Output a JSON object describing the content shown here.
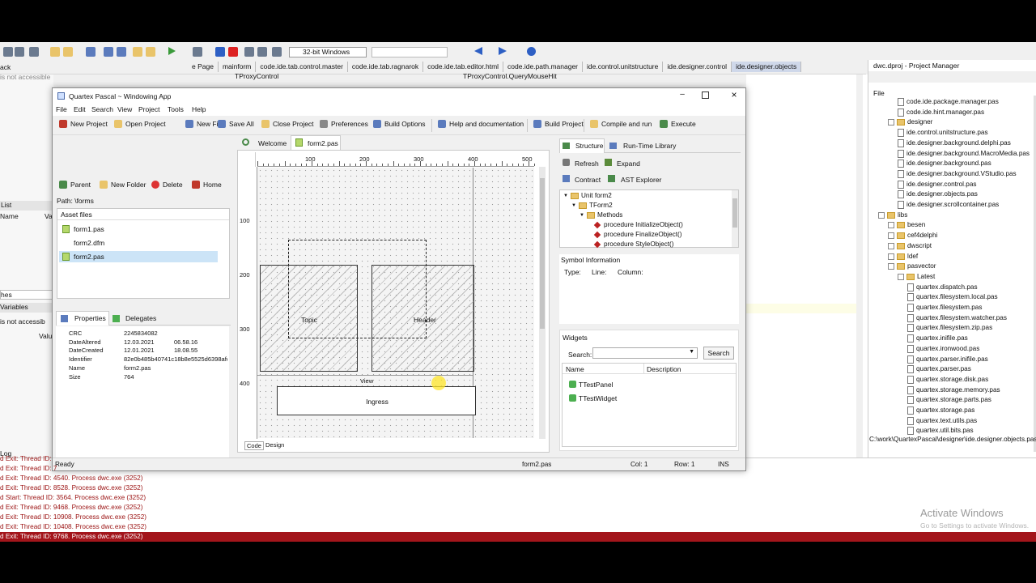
{
  "bg": {
    "tabs": [
      "e Page",
      "mainform",
      "code.ide.tab.control.master",
      "code.ide.tab.ragnarok",
      "code.ide.tab.editor.html",
      "code.ide.path.manager",
      "ide.control.unitstructure",
      "ide.designer.control",
      "ide.designer.objects"
    ],
    "platform": "32-bit Windows",
    "class_left": "TProxyControl",
    "method_right": "TProxyControl.QueryMouseHit",
    "left_texts": [
      "ack",
      "is not accessible",
      "List",
      "Name",
      "Va",
      "hes",
      "Variables",
      "is not accessib",
      "Valu",
      "Log"
    ],
    "editor_lines": []
  },
  "project_manager": {
    "title": "dwc.dproj - Project Manager",
    "tab": "File",
    "items": [
      {
        "t": "code.ide.package.manager.pas",
        "k": "doc",
        "l": 2
      },
      {
        "t": "code.ide.hint.manager.pas",
        "k": "doc",
        "l": 2
      },
      {
        "t": "designer",
        "k": "fold",
        "l": 1
      },
      {
        "t": "ide.control.unitstructure.pas",
        "k": "doc",
        "l": 2
      },
      {
        "t": "ide.designer.background.delphi.pas",
        "k": "doc",
        "l": 2
      },
      {
        "t": "ide.designer.background.MacroMedia.pas",
        "k": "doc",
        "l": 2
      },
      {
        "t": "ide.designer.background.pas",
        "k": "doc",
        "l": 2
      },
      {
        "t": "ide.designer.background.VStudio.pas",
        "k": "doc",
        "l": 2
      },
      {
        "t": "ide.designer.control.pas",
        "k": "doc",
        "l": 2
      },
      {
        "t": "ide.designer.objects.pas",
        "k": "doc",
        "l": 2
      },
      {
        "t": "ide.designer.scrollcontainer.pas",
        "k": "doc",
        "l": 2
      },
      {
        "t": "libs",
        "k": "fold",
        "l": 0
      },
      {
        "t": "besen",
        "k": "fold",
        "l": 1
      },
      {
        "t": "cef4delphi",
        "k": "fold",
        "l": 1
      },
      {
        "t": "dwscript",
        "k": "fold",
        "l": 1
      },
      {
        "t": "ldef",
        "k": "fold",
        "l": 1
      },
      {
        "t": "pasvector",
        "k": "fold",
        "l": 1
      },
      {
        "t": "Latest",
        "k": "fold",
        "l": 2
      },
      {
        "t": "quartex.dispatch.pas",
        "k": "doc",
        "l": 3
      },
      {
        "t": "quartex.filesystem.local.pas",
        "k": "doc",
        "l": 3
      },
      {
        "t": "quartex.filesystem.pas",
        "k": "doc",
        "l": 3
      },
      {
        "t": "quartex.filesystem.watcher.pas",
        "k": "doc",
        "l": 3
      },
      {
        "t": "quartex.filesystem.zip.pas",
        "k": "doc",
        "l": 3
      },
      {
        "t": "quartex.inifile.pas",
        "k": "doc",
        "l": 3
      },
      {
        "t": "quartex.ironwood.pas",
        "k": "doc",
        "l": 3
      },
      {
        "t": "quartex.parser.inifile.pas",
        "k": "doc",
        "l": 3
      },
      {
        "t": "quartex.parser.pas",
        "k": "doc",
        "l": 3
      },
      {
        "t": "quartex.storage.disk.pas",
        "k": "doc",
        "l": 3
      },
      {
        "t": "quartex.storage.memory.pas",
        "k": "doc",
        "l": 3
      },
      {
        "t": "quartex.storage.parts.pas",
        "k": "doc",
        "l": 3
      },
      {
        "t": "quartex.storage.pas",
        "k": "doc",
        "l": 3
      },
      {
        "t": "quartex.text.utils.pas",
        "k": "doc",
        "l": 3
      },
      {
        "t": "quartex.util.bits.pas",
        "k": "doc",
        "l": 3
      }
    ],
    "path": "C:\\work\\QuartexPascal\\designer\\ide.designer.objects.pas"
  },
  "log": {
    "lines": [
      "d Exit: Thread ID: ",
      "d Exit: Thread ID: 7",
      "d Exit: Thread ID: 4540. Process dwc.exe (3252)",
      "d Exit: Thread ID: 8528. Process dwc.exe (3252)",
      "d Start: Thread ID: 3564. Process dwc.exe (3252)",
      "d Exit: Thread ID: 9468. Process dwc.exe (3252)",
      "d Exit: Thread ID: 10908. Process dwc.exe (3252)",
      "d Exit: Thread ID: 10408. Process dwc.exe (3252)",
      "d Exit: Thread ID: 9768. Process dwc.exe (3252)"
    ]
  },
  "watermark": {
    "line1": "Activate Windows",
    "line2": "Go to Settings to activate Windows."
  },
  "app": {
    "title": "Quartex Pascal ~ Windowing App",
    "menu": [
      "File",
      "Edit",
      "Search",
      "View",
      "Project",
      "Tools",
      "Help"
    ],
    "toolbar": [
      "New Project",
      "Open Project",
      "New File",
      "Save All",
      "Close Project",
      "Preferences",
      "Build Options",
      "Help and documentation",
      "Build Project",
      "Compile and run",
      "Execute"
    ],
    "filebar": [
      "Parent",
      "New Folder",
      "Delete",
      "Home"
    ],
    "path": "Path: \\forms",
    "asset_header": "Asset files",
    "assets": [
      "form1.pas",
      "form2.dfm",
      "form2.pas"
    ],
    "selected_asset": 2,
    "prop_tabs": [
      "Properties",
      "Delegates"
    ],
    "properties": [
      {
        "k": "CRC",
        "v": "2245834082",
        "v2": ""
      },
      {
        "k": "DateAltered",
        "v": "12.03.2021",
        "v2": "06.58.16"
      },
      {
        "k": "DateCreated",
        "v": "12.01.2021",
        "v2": "18.08.55"
      },
      {
        "k": "Identifier",
        "v": "82e0b485b40741c18b8e5525d6398afc",
        "v2": ""
      },
      {
        "k": "Name",
        "v": "form2.pas",
        "v2": ""
      },
      {
        "k": "Size",
        "v": "764",
        "v2": ""
      }
    ],
    "doc_tabs": [
      "Welcome",
      "form2.pas"
    ],
    "ruler_top": [
      "100",
      "200",
      "300",
      "400",
      "500"
    ],
    "ruler_left": [
      "100",
      "200",
      "300",
      "400"
    ],
    "canvas_labels": {
      "topic": "Topic",
      "header": "Header",
      "view": "View",
      "ingress": "Ingress"
    },
    "bottom_tabs": [
      "Code",
      "Design"
    ],
    "right_tabs": [
      "Structure",
      "Run-Time Library"
    ],
    "right_buttons": [
      "Refresh",
      "Expand",
      "Contract",
      "AST Explorer"
    ],
    "tree": [
      {
        "t": "Unit form2",
        "l": 0,
        "k": "fold"
      },
      {
        "t": "TForm2",
        "l": 1,
        "k": "fold"
      },
      {
        "t": "Methods",
        "l": 2,
        "k": "fold"
      },
      {
        "t": "procedure InitializeObject()",
        "l": 3,
        "k": "red"
      },
      {
        "t": "procedure FinalizeObject()",
        "l": 3,
        "k": "red"
      },
      {
        "t": "procedure StyleObject()",
        "l": 3,
        "k": "red"
      }
    ],
    "symbol": {
      "title": "Symbol Information",
      "type": "Type:",
      "line": "Line:",
      "column": "Column:"
    },
    "widgets": {
      "title": "Widgets",
      "search_label": "Search:",
      "search_button": "Search",
      "col_name": "Name",
      "col_desc": "Description",
      "items": [
        "TTestPanel",
        "TTestWidget"
      ]
    },
    "status": {
      "ready": "Ready",
      "file": "form2.pas",
      "col": "Col: 1",
      "row": "Row: 1",
      "mode": "INS"
    }
  }
}
